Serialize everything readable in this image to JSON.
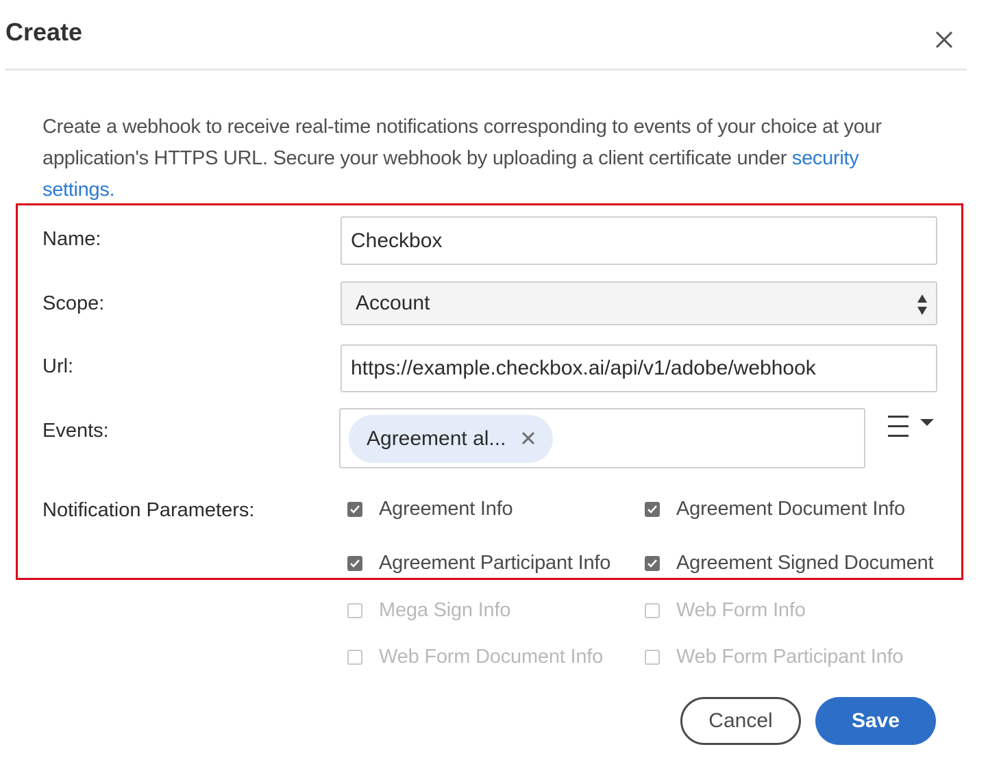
{
  "dialog": {
    "title": "Create",
    "intro_text": "Create a webhook to receive real-time notifications corresponding to events of your choice at your application's HTTPS URL. Secure your webhook by uploading a client certificate under ",
    "intro_link": "security settings."
  },
  "form": {
    "name_label": "Name:",
    "name_value": "Checkbox",
    "scope_label": "Scope:",
    "scope_value": "Account",
    "url_label": "Url:",
    "url_value": "https://example.checkbox.ai/api/v1/adobe/webhook",
    "events_label": "Events:",
    "events_chip": "Agreement al...",
    "notif_label": "Notification Parameters:",
    "params": [
      {
        "label": "Agreement Info",
        "checked": true
      },
      {
        "label": "Agreement Document Info",
        "checked": true
      },
      {
        "label": "Agreement Participant Info",
        "checked": true
      },
      {
        "label": "Agreement Signed Document",
        "checked": true
      },
      {
        "label": "Mega Sign Info",
        "checked": false
      },
      {
        "label": "Web Form Info",
        "checked": false
      },
      {
        "label": "Web Form Document Info",
        "checked": false
      },
      {
        "label": "Web Form Participant Info",
        "checked": false
      }
    ]
  },
  "buttons": {
    "cancel": "Cancel",
    "save": "Save"
  },
  "colors": {
    "link": "#2d7bd5",
    "primary": "#2d6fc7",
    "highlight": "#d9001b",
    "chip_bg": "#e3ecf8"
  }
}
